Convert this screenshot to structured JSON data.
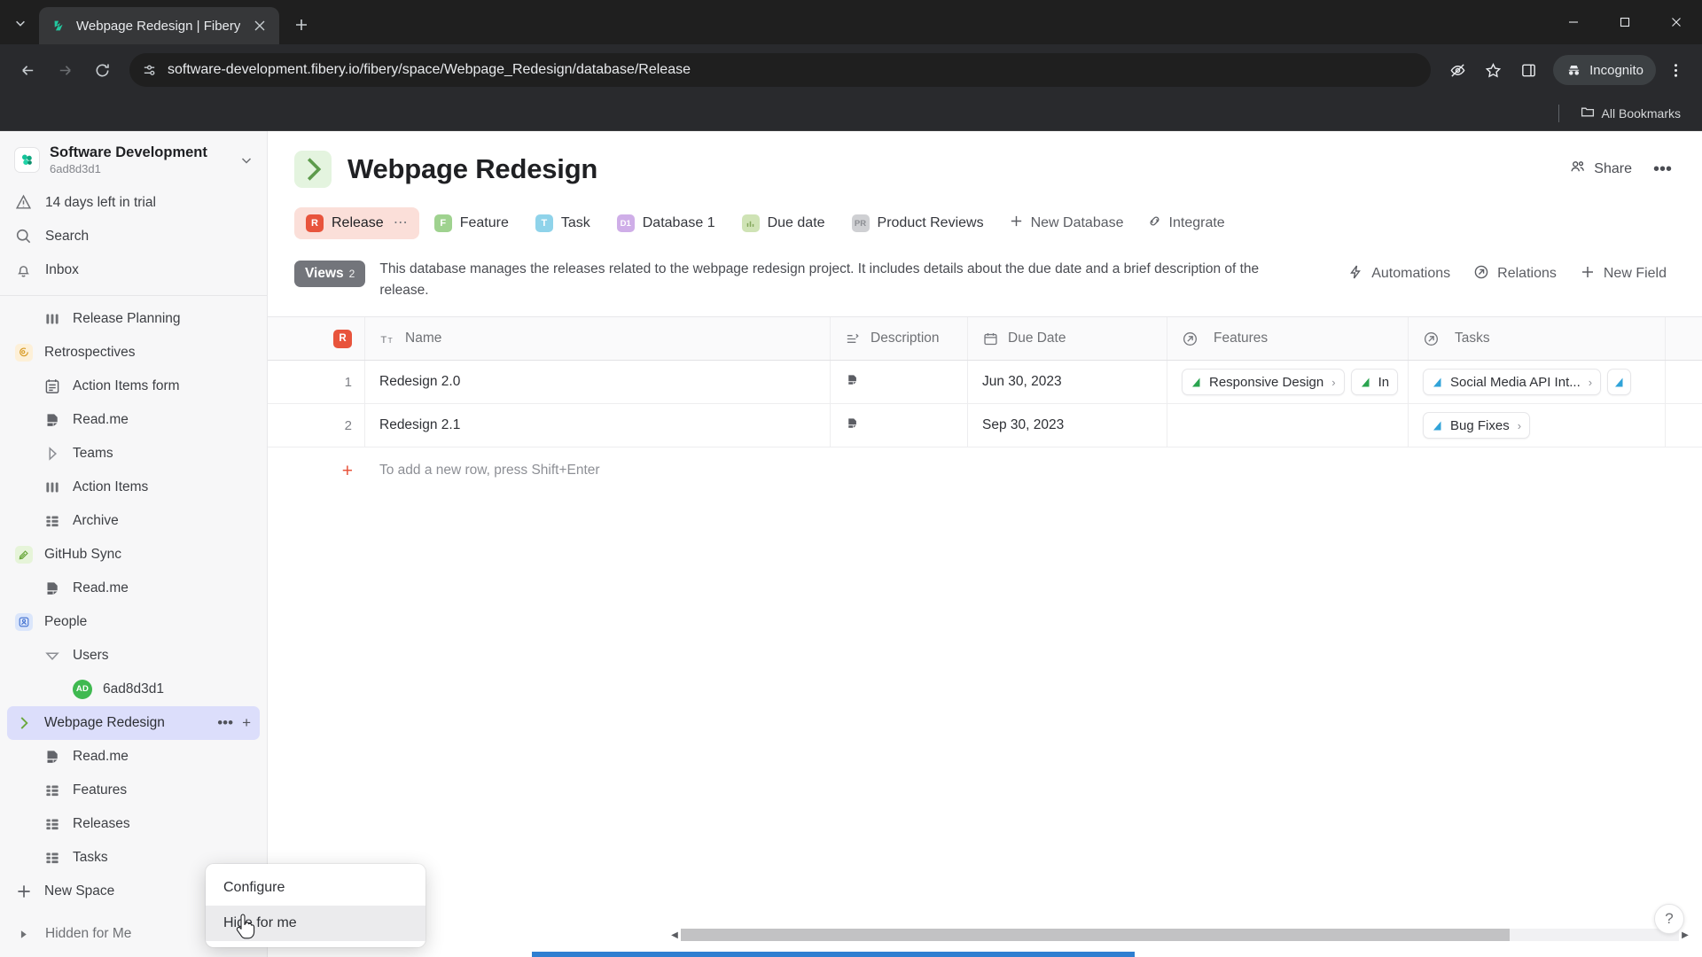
{
  "browser": {
    "tab": {
      "title": "Webpage Redesign | Fibery",
      "favicon": "fibery-logo-icon"
    },
    "new_tab_label": "+",
    "url": "software-development.fibery.io/fibery/space/Webpage_Redesign/database/Release",
    "incognito_label": "Incognito",
    "bookmarks_label": "All Bookmarks",
    "window_controls": {
      "minimize": "minimize-icon",
      "maximize": "maximize-icon",
      "close": "close-icon"
    }
  },
  "sidebar": {
    "workspace": {
      "name": "Software Development",
      "id": "6ad8d3d1"
    },
    "nav": [
      {
        "label": "14 days left in trial",
        "icon": "warning-triangle-icon"
      },
      {
        "label": "Search",
        "icon": "search-icon"
      },
      {
        "label": "Inbox",
        "icon": "bell-icon"
      }
    ],
    "tree": [
      {
        "label": "Release Planning",
        "icon": "columns-icon",
        "level": 1,
        "icon_color": "#6f7175"
      },
      {
        "label": "Retrospectives",
        "icon": "retro-icon",
        "level": 0,
        "icon_bg": "#fdf0d8",
        "icon_color": "#d79a25"
      },
      {
        "label": "Action Items form",
        "icon": "form-icon",
        "level": 1,
        "icon_color": "#5b5d63"
      },
      {
        "label": "Read.me",
        "icon": "doc-icon",
        "level": 1,
        "icon_color": "#5b5d63"
      },
      {
        "label": "Teams",
        "icon": "chevron-right-outline-icon",
        "level": 1,
        "icon_color": "#8d8f95"
      },
      {
        "label": "Action Items",
        "icon": "columns-icon",
        "level": 1,
        "icon_color": "#6f7175"
      },
      {
        "label": "Archive",
        "icon": "grid-icon",
        "level": 1,
        "icon_color": "#6f7175"
      },
      {
        "label": "GitHub Sync",
        "icon": "sync-icon",
        "level": 0,
        "icon_bg": "#e6f4d9",
        "icon_color": "#6aa83c"
      },
      {
        "label": "Read.me",
        "icon": "doc-icon",
        "level": 1,
        "icon_color": "#5b5d63"
      },
      {
        "label": "People",
        "icon": "people-icon",
        "level": 0,
        "icon_bg": "#dbe6fb",
        "icon_color": "#3f6fd0"
      },
      {
        "label": "Users",
        "icon": "chevron-down-outline-icon",
        "level": 1,
        "icon_color": "#8d8f95"
      },
      {
        "label": "6ad8d3d1",
        "icon": "avatar-icon",
        "level": 2,
        "avatar_initials": "AD",
        "avatar_color": "#3fb950"
      }
    ],
    "selected_space": {
      "label": "Webpage Redesign",
      "icon": "chevron-right-icon",
      "dots": "•••",
      "plus": "+"
    },
    "space_children": [
      {
        "label": "Read.me",
        "icon": "doc-icon"
      },
      {
        "label": "Features",
        "icon": "grid-icon"
      },
      {
        "label": "Releases",
        "icon": "grid-icon"
      },
      {
        "label": "Tasks",
        "icon": "grid-icon"
      }
    ],
    "new_space": {
      "label": "New Space",
      "icon": "plus-icon"
    },
    "hidden_for_me": {
      "label": "Hidden for Me",
      "icon": "triangle-right-icon"
    }
  },
  "context_menu": {
    "items": [
      {
        "label": "Configure",
        "hovered": false
      },
      {
        "label": "Hide for me",
        "hovered": true
      }
    ]
  },
  "main": {
    "title": "Webpage Redesign",
    "share_label": "Share",
    "more_label": "•••",
    "database_tabs": [
      {
        "label": "Release",
        "badge": "R",
        "color": "#e8543c",
        "active": true,
        "has_dots": true
      },
      {
        "label": "Feature",
        "badge": "F",
        "color": "#9fd28f",
        "active": false
      },
      {
        "label": "Task",
        "badge": "T",
        "color": "#8fd3ea",
        "active": false
      },
      {
        "label": "Database 1",
        "badge": "D1",
        "color": "#cfaee8",
        "active": false
      },
      {
        "label": "Due date",
        "badge": "▐▐",
        "color": "#cfe3b5",
        "active": false
      },
      {
        "label": "Product Reviews",
        "badge": "PR",
        "color": "#cfd0d3",
        "active": false
      }
    ],
    "database_actions": [
      {
        "label": "New Database",
        "icon": "plus-icon"
      },
      {
        "label": "Integrate",
        "icon": "integrate-icon"
      }
    ],
    "views": {
      "label": "Views",
      "count": "2"
    },
    "description": "This database manages the releases related to the webpage redesign project. It includes details about the due date and a brief description of the release.",
    "toolbar": [
      {
        "label": "Automations",
        "icon": "lightning-icon"
      },
      {
        "label": "Relations",
        "icon": "relation-arrow-icon"
      },
      {
        "label": "New Field",
        "icon": "plus-icon"
      }
    ]
  },
  "table": {
    "columns": [
      {
        "label": "",
        "icon": "release-badge-icon",
        "key": "rownum"
      },
      {
        "label": "Name",
        "icon": "text-format-icon",
        "key": "name"
      },
      {
        "label": "Description",
        "icon": "rich-text-icon",
        "key": "description"
      },
      {
        "label": "Due Date",
        "icon": "calendar-icon",
        "key": "due_date"
      },
      {
        "label": "Features",
        "icon": "relation-arrow-icon",
        "key": "features"
      },
      {
        "label": "Tasks",
        "icon": "relation-arrow-icon",
        "key": "tasks"
      }
    ],
    "rows": [
      {
        "num": "1",
        "name": "Redesign 2.0",
        "description_icon": "doc-icon",
        "due_date": "Jun 30, 2023",
        "features": [
          {
            "label": "Responsive Design",
            "color": "#2aa44f"
          },
          {
            "label": "In",
            "color": "#2aa44f",
            "truncated": true
          }
        ],
        "tasks": [
          {
            "label": "Social Media API Int...",
            "color": "#30a3d8"
          },
          {
            "label": "",
            "color": "#30a3d8",
            "truncated": true
          }
        ]
      },
      {
        "num": "2",
        "name": "Redesign 2.1",
        "description_icon": "doc-icon",
        "due_date": "Sep 30, 2023",
        "features": [],
        "tasks": [
          {
            "label": "Bug Fixes",
            "color": "#30a3d8"
          }
        ]
      }
    ],
    "add_row_hint": "To add a new row, press Shift+Enter",
    "add_row_plus": "+"
  },
  "footer": {
    "help_label": "?",
    "scroll_left_arrow": "◀",
    "scroll_right_arrow": "▶"
  }
}
